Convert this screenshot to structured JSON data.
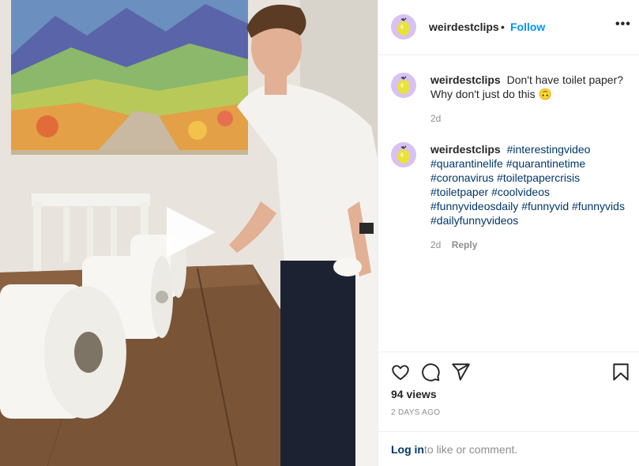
{
  "post": {
    "username": "weirdestclips",
    "dot": "•",
    "follow_label": "Follow",
    "more_label": "•••",
    "avatar_icon": "lemon-avatar-icon",
    "follow_color": "#0095f6"
  },
  "media": {
    "type": "video",
    "play_icon": "play-icon"
  },
  "comments": [
    {
      "username": "weirdestclips",
      "text": "Don't have toilet paper? Why don't just do this 🙃",
      "time": "2d"
    },
    {
      "username": "weirdestclips",
      "hashtags": [
        "#interestingvideo",
        "#quarantinelife",
        "#quarantinetime",
        "#coronavirus",
        "#toiletpapercrisis",
        "#toiletpaper",
        "#coolvideos",
        "#funnyvideosdaily",
        "#funnyvid",
        "#funnyvids",
        "#dailyfunnyvideos"
      ],
      "time": "2d",
      "reply_label": "Reply"
    }
  ],
  "actions": {
    "like_icon": "heart-icon",
    "comment_icon": "comment-icon",
    "share_icon": "share-icon",
    "save_icon": "bookmark-icon",
    "views": "94 views",
    "time_ago": "2 DAYS AGO",
    "login_label": "Log in",
    "login_rest": "to like or comment."
  },
  "colors": {
    "hashtag": "#00376b",
    "avatar_bg": "#d7c2f2",
    "divider": "#efefef"
  }
}
